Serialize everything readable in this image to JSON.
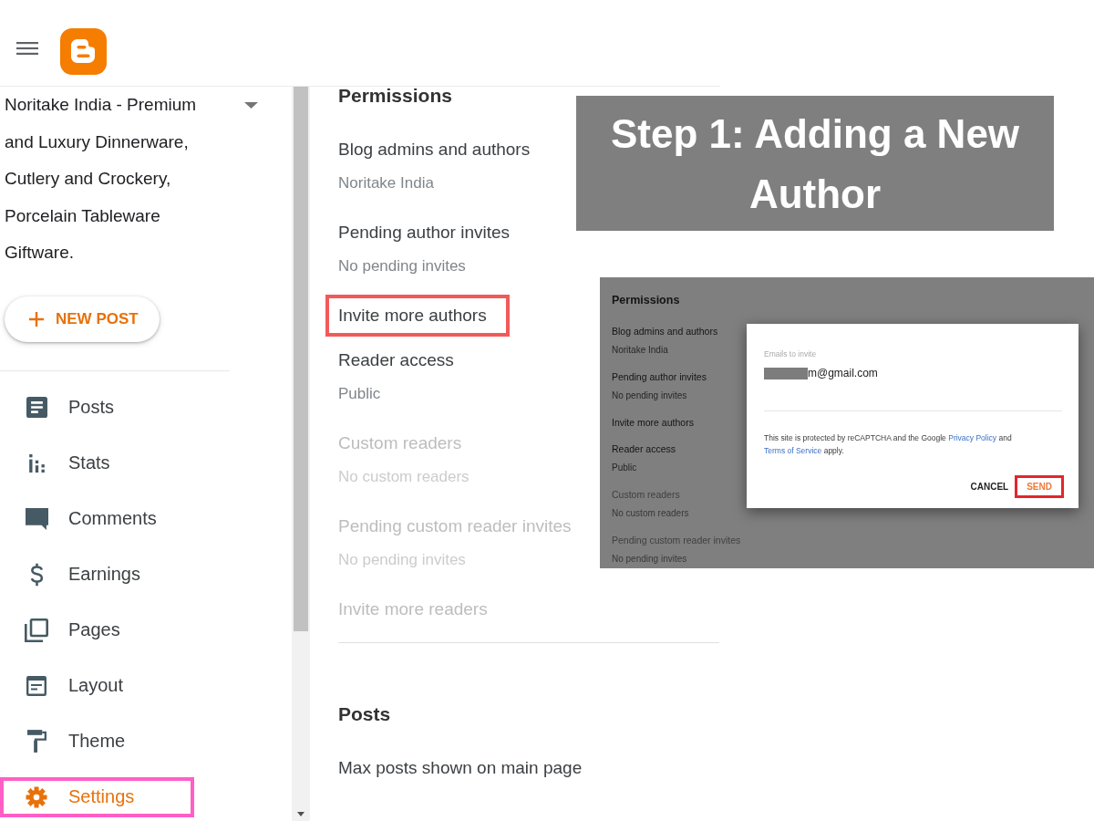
{
  "sidebar": {
    "blog_title": "Noritake India - Premium and Luxury Dinnerware, Cutlery and Crockery, Porcelain Tableware Giftware.",
    "new_post_button": {
      "label": "NEW POST"
    },
    "nav_items": [
      {
        "label": "Posts",
        "kind": "posts",
        "selected": false,
        "highlighted": false
      },
      {
        "label": "Stats",
        "kind": "stats",
        "selected": false,
        "highlighted": false
      },
      {
        "label": "Comments",
        "kind": "comments",
        "selected": false,
        "highlighted": false
      },
      {
        "label": "Earnings",
        "kind": "earnings",
        "selected": false,
        "highlighted": false
      },
      {
        "label": "Pages",
        "kind": "pages",
        "selected": false,
        "highlighted": false
      },
      {
        "label": "Layout",
        "kind": "layout",
        "selected": false,
        "highlighted": false
      },
      {
        "label": "Theme",
        "kind": "theme",
        "selected": false,
        "highlighted": false
      },
      {
        "label": "Settings",
        "kind": "settings",
        "selected": true,
        "highlighted": true
      }
    ]
  },
  "settings_sections": [
    {
      "heading": "Permissions",
      "items": [
        {
          "label": "Blog admins and authors",
          "value": "Noritake India",
          "disabled": false,
          "highlighted": false
        },
        {
          "label": "Pending author invites",
          "value": "No pending invites",
          "disabled": false,
          "highlighted": false
        },
        {
          "label": "Invite more authors",
          "disabled": false,
          "highlighted": true
        },
        {
          "label": "Reader access",
          "value": "Public",
          "disabled": false,
          "highlighted": false
        },
        {
          "label": "Custom readers",
          "value": "No custom readers",
          "disabled": true,
          "highlighted": false
        },
        {
          "label": "Pending custom reader invites",
          "value": "No pending invites",
          "disabled": true,
          "highlighted": false
        },
        {
          "label": "Invite more readers",
          "disabled": true,
          "highlighted": false
        }
      ]
    },
    {
      "heading": "Posts",
      "items": [
        {
          "label": "Max posts shown on main page",
          "disabled": false,
          "highlighted": false
        }
      ]
    }
  ],
  "annotation_banner": {
    "text": "Step 1: Adding a New Author"
  },
  "inset_screenshot": {
    "heading": "Permissions",
    "items": [
      {
        "label": "Blog admins and authors",
        "value": "Noritake India",
        "disabled": false
      },
      {
        "label": "Pending author invites",
        "value": "No pending invites",
        "disabled": false
      },
      {
        "label": "Invite more authors",
        "disabled": false
      },
      {
        "label": "Reader access",
        "value": "Public",
        "disabled": false
      },
      {
        "label": "Custom readers",
        "value": "No custom readers",
        "disabled": true
      },
      {
        "label": "Pending custom reader invites",
        "value": "No pending invites",
        "disabled": true
      }
    ],
    "invite_dialog": {
      "field_label": "Emails to invite",
      "field_value": "m@gmail.com",
      "redacted": true,
      "notice": [
        {
          "text": "This site is protected by reCAPTCHA and the Google ",
          "link": false
        },
        {
          "text": "Privacy Policy",
          "link": true
        },
        {
          "text": " and ",
          "link": false
        },
        {
          "text": "Terms of Service",
          "link": true
        },
        {
          "text": " apply.",
          "link": false
        }
      ],
      "buttons": [
        {
          "label": "CANCEL",
          "kind": "plain",
          "highlighted": false
        },
        {
          "label": "SEND",
          "kind": "primary",
          "highlighted": true
        }
      ]
    }
  }
}
